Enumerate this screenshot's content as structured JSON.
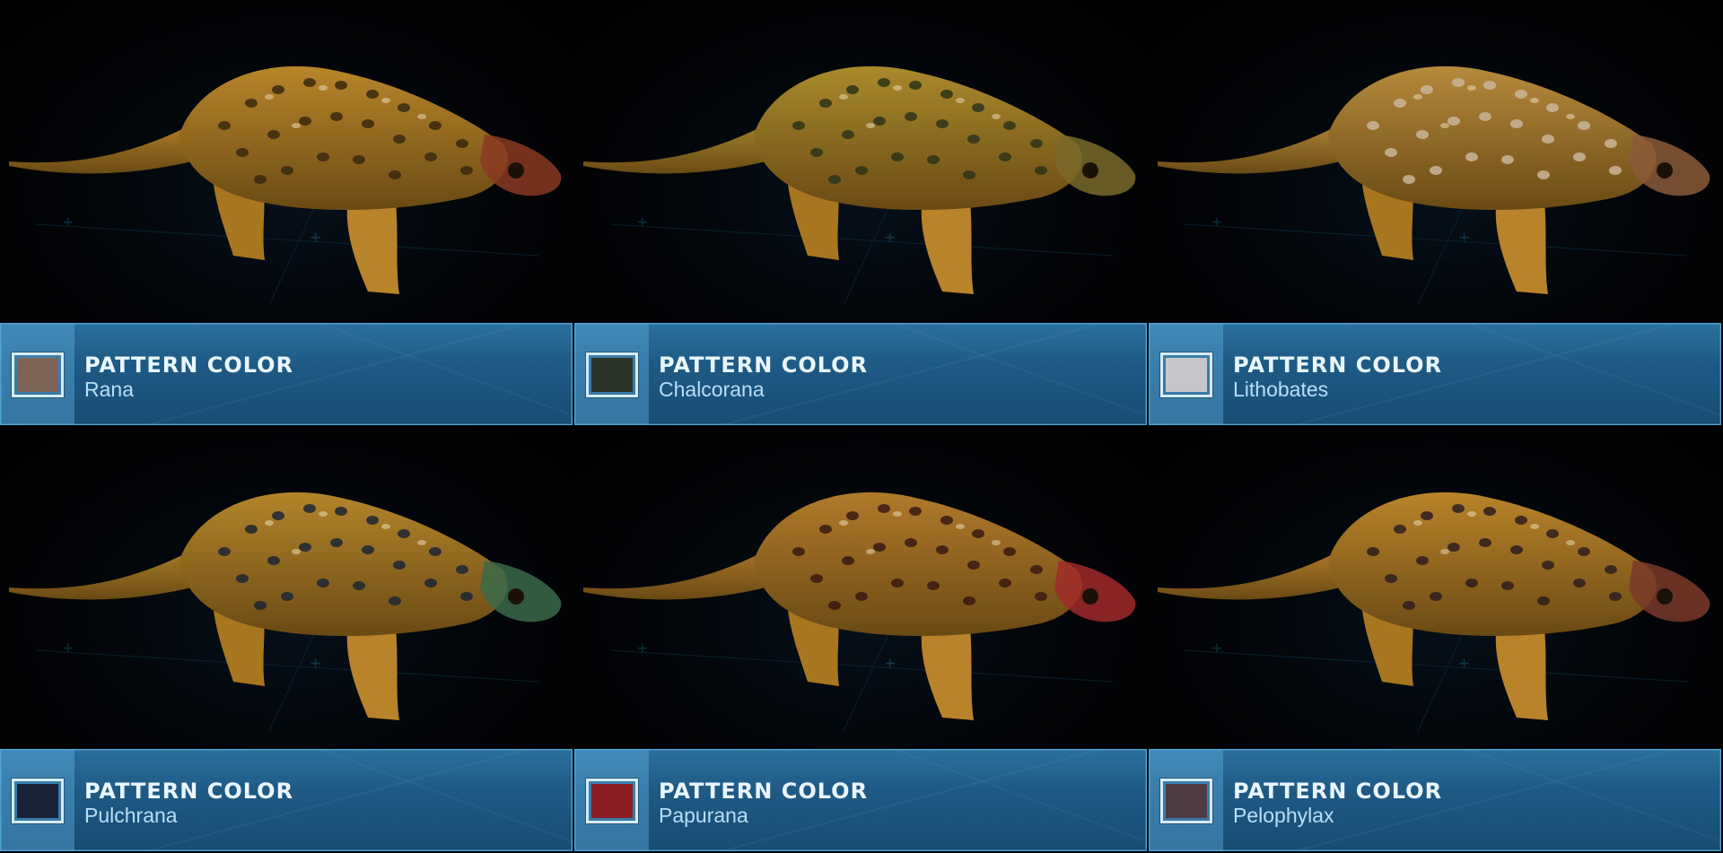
{
  "cards": [
    {
      "title": "PATTERN COLOR",
      "name": "Rana",
      "swatch": "#7d6457",
      "body": "#b8862a",
      "accent": "#3a2a10",
      "head": "#8a3a22"
    },
    {
      "title": "PATTERN COLOR",
      "name": "Chalcorana",
      "swatch": "#2a3528",
      "body": "#a98a2c",
      "accent": "#2e3418",
      "head": "#7a6a2a"
    },
    {
      "title": "PATTERN COLOR",
      "name": "Lithobates",
      "swatch": "#c9c6cb",
      "body": "#b58a3c",
      "accent": "#c9b69a",
      "head": "#8a5a3a"
    },
    {
      "title": "PATTERN COLOR",
      "name": "Pulchrana",
      "swatch": "#1a2238",
      "body": "#b3852a",
      "accent": "#1e2633",
      "head": "#3a6a4a"
    },
    {
      "title": "PATTERN COLOR",
      "name": "Papurana",
      "swatch": "#8a1e24",
      "body": "#b07a2a",
      "accent": "#3a1a12",
      "head": "#a02a2a"
    },
    {
      "title": "PATTERN COLOR",
      "name": "Pelophylax",
      "swatch": "#4e3c44",
      "body": "#b9842a",
      "accent": "#2e1e1e",
      "head": "#7a3a2a"
    }
  ]
}
